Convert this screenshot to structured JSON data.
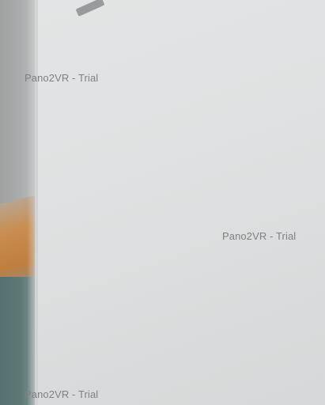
{
  "watermarks": [
    {
      "text": "Pano2VR - Trial"
    },
    {
      "text": "Pano2VR - Trial"
    },
    {
      "text": "Pano2VR - Trial"
    }
  ],
  "colors": {
    "wall": "#dcdedf",
    "beam": "#c98d4f",
    "lower_panel": "#5f7977",
    "watermark_text": "#7e8081"
  }
}
